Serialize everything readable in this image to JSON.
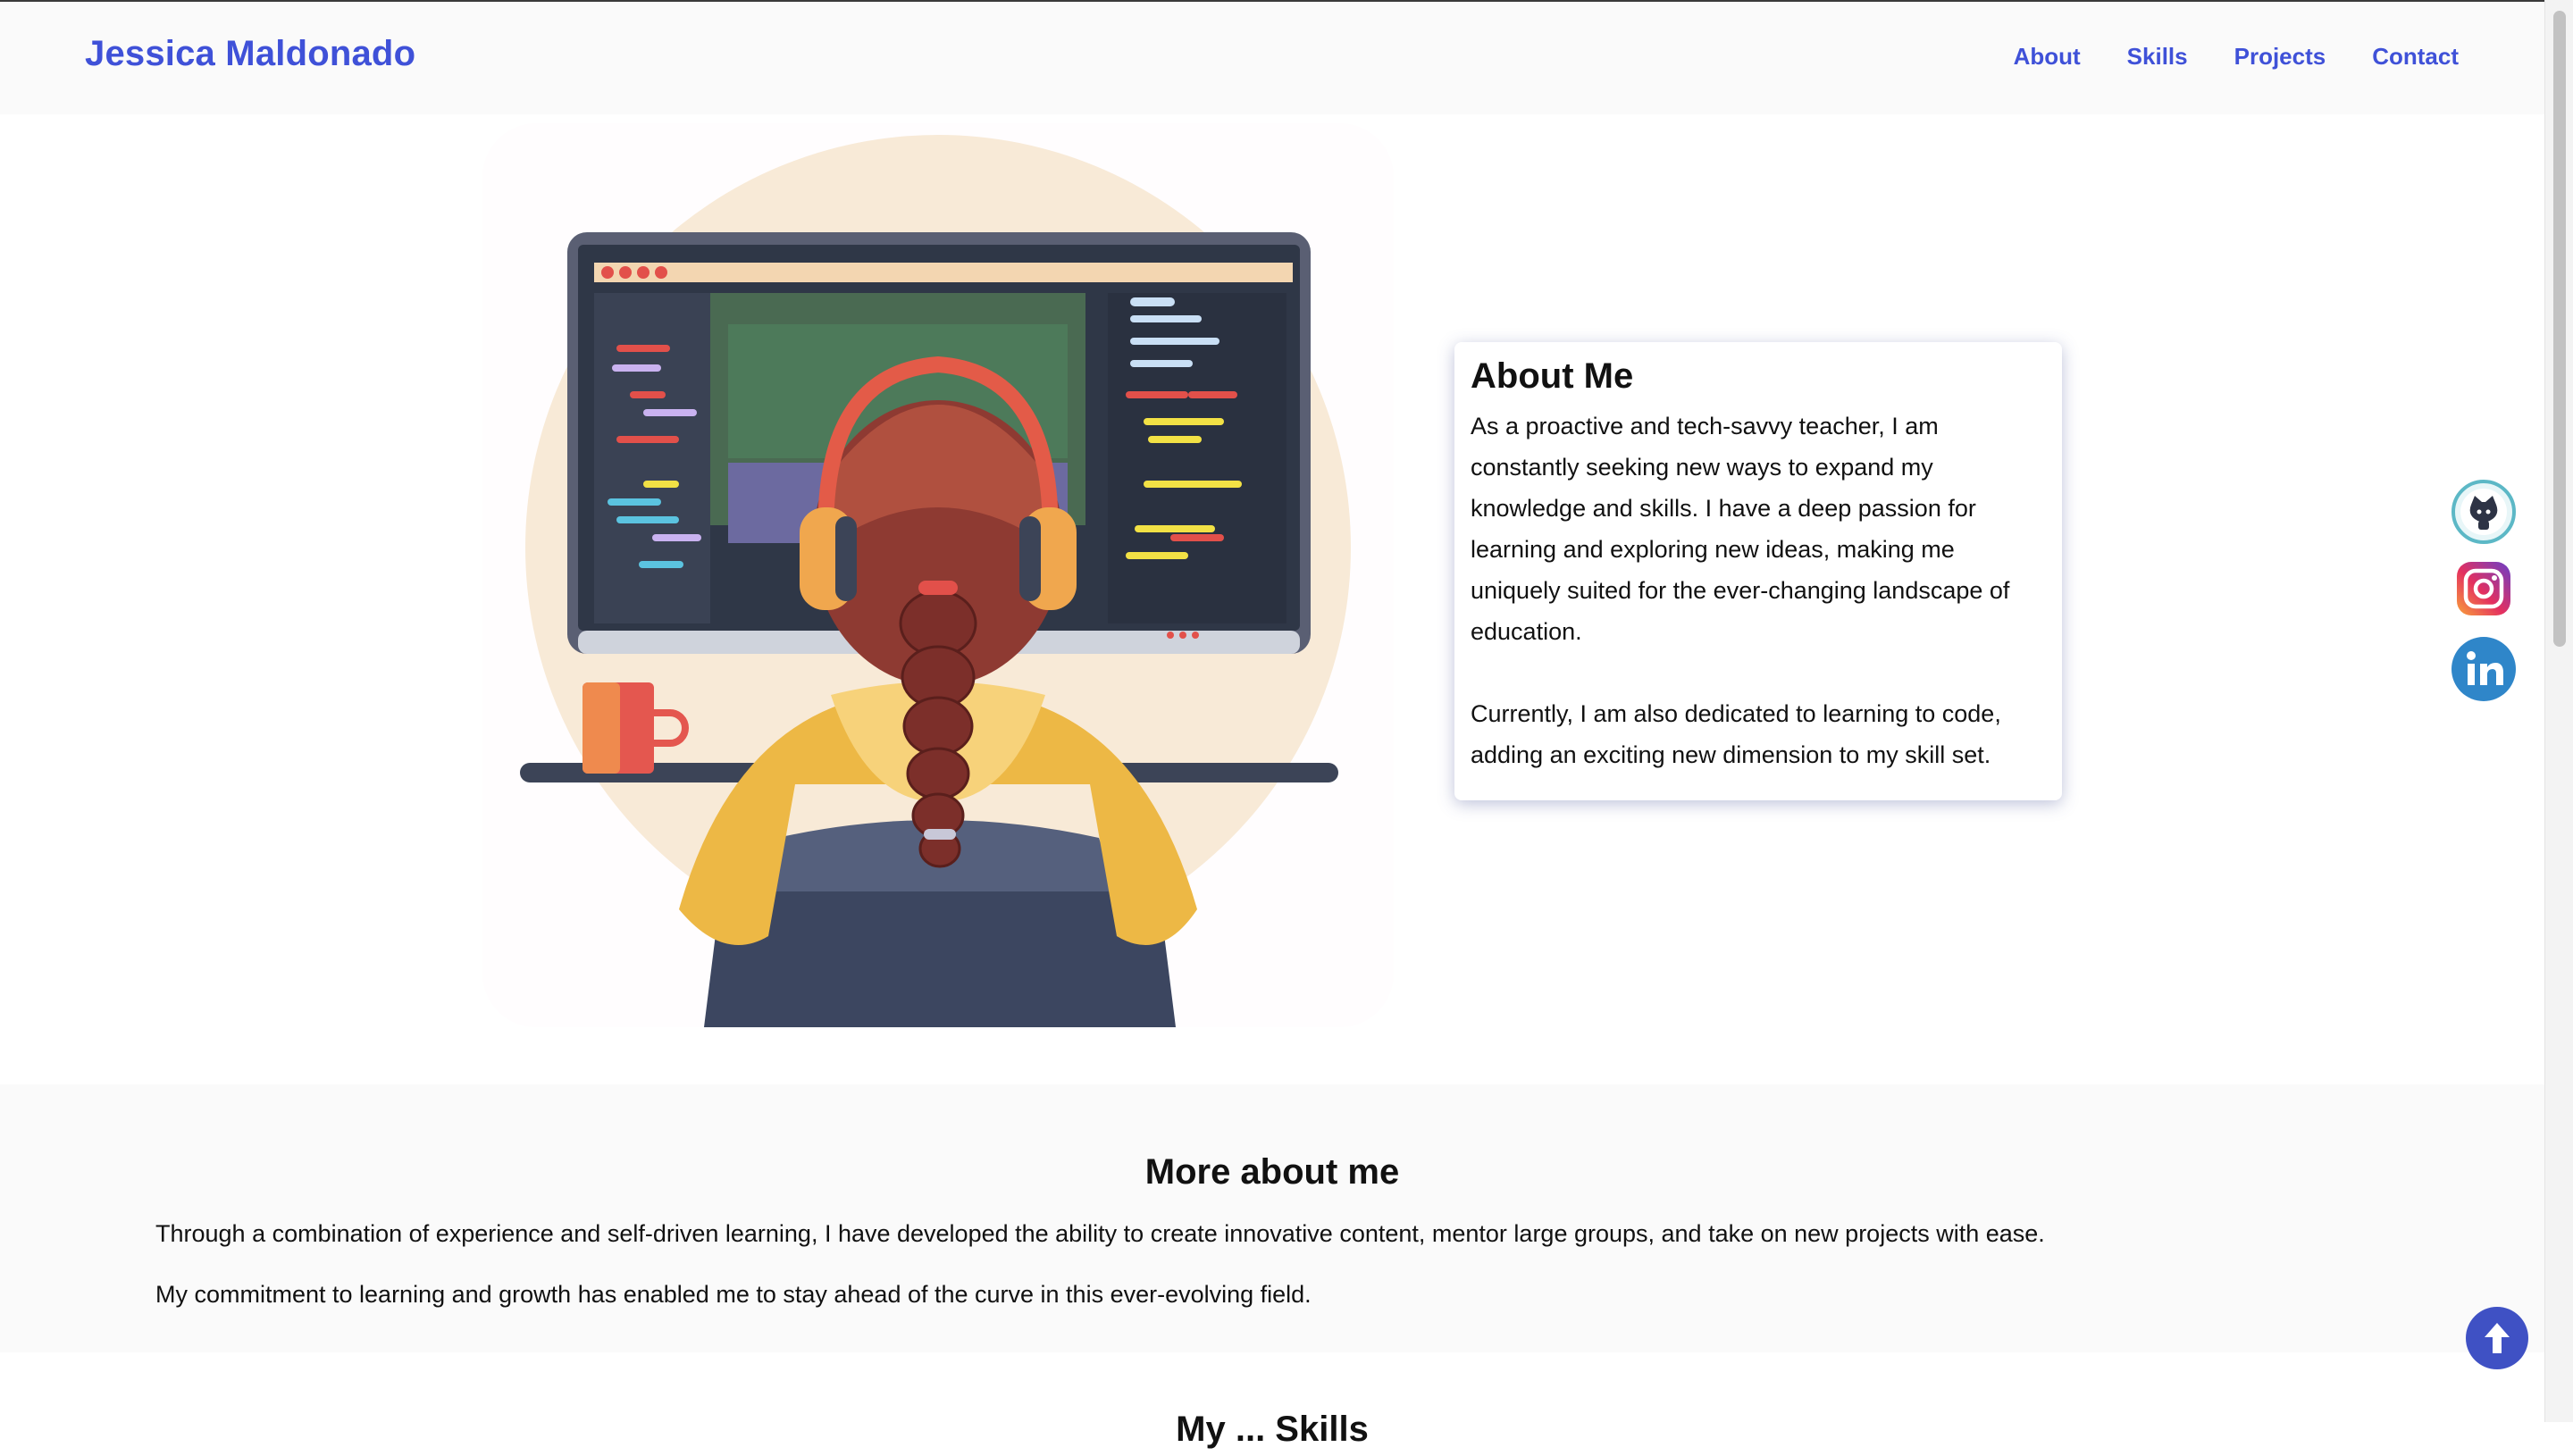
{
  "header": {
    "brand": "Jessica Maldonado",
    "nav": [
      "About",
      "Skills",
      "Projects",
      "Contact"
    ]
  },
  "hero": {
    "illustration": "developer-at-computer-illustration"
  },
  "about": {
    "title": "About Me",
    "paragraphs": [
      "As a proactive and tech-savvy teacher, I am constantly seeking new ways to expand my knowledge and skills. I have a deep passion for learning and exploring new ideas, making me uniquely suited for the ever-changing landscape of education.",
      "Currently, I am also dedicated to learning to code, adding an exciting new dimension to my skill set."
    ]
  },
  "social": [
    "github-icon",
    "instagram-icon",
    "linkedin-icon"
  ],
  "more": {
    "title": "More about me",
    "p1": "Through a combination of experience and self-driven learning, I have developed the ability to create innovative content, mentor large groups, and take on new projects with ease.",
    "p2": "My commitment to learning and growth has enabled me to stay ahead of the curve in this ever-evolving field."
  },
  "next_section_title": "My ... Skills",
  "colors": {
    "accent": "#3f51d8",
    "back_to_top": "#3f51c4"
  }
}
